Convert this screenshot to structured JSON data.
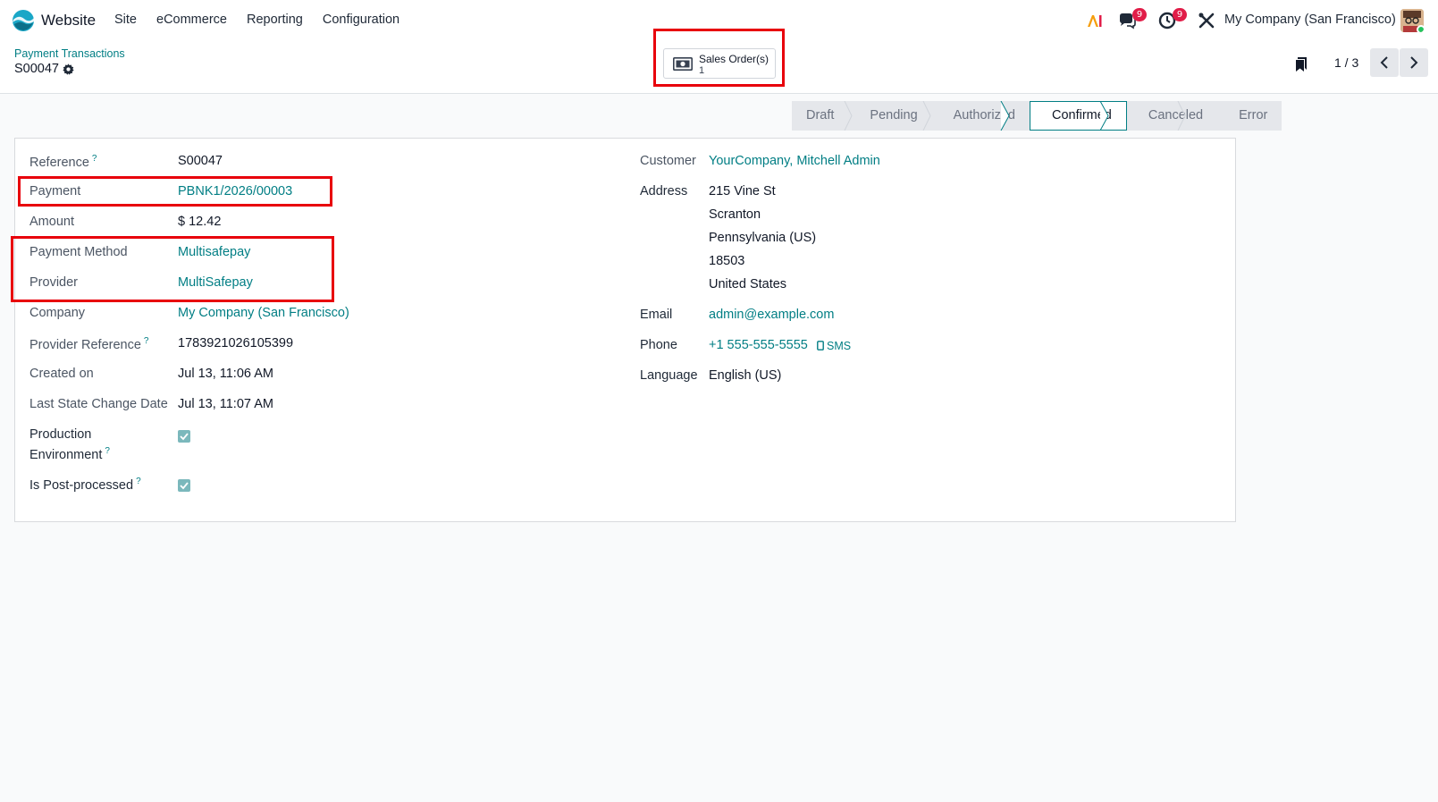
{
  "navbar": {
    "app_name": "Website",
    "menu": [
      "Site",
      "eCommerce",
      "Reporting",
      "Configuration"
    ],
    "messages_badge": "9",
    "activities_badge": "9",
    "company": "My Company (San Francisco)"
  },
  "control": {
    "breadcrumb": "Payment Transactions",
    "record": "S00047",
    "smart_button": {
      "label": "Sales Order(s)",
      "count": "1",
      "icon": "money-icon"
    },
    "pager": "1 / 3"
  },
  "statusbar": {
    "stages": [
      "Draft",
      "Pending",
      "Authorized",
      "Confirmed",
      "Canceled",
      "Error"
    ],
    "active": "Confirmed"
  },
  "left": {
    "reference": {
      "label": "Reference",
      "value": "S00047"
    },
    "payment": {
      "label": "Payment",
      "value": "PBNK1/2026/00003"
    },
    "amount": {
      "label": "Amount",
      "value": "$ 12.42"
    },
    "payment_method": {
      "label": "Payment Method",
      "value": "Multisafepay"
    },
    "provider": {
      "label": "Provider",
      "value": "MultiSafepay"
    },
    "company": {
      "label": "Company",
      "value": "My Company (San Francisco)"
    },
    "provider_reference": {
      "label": "Provider Reference",
      "value": "1783921026105399"
    },
    "created_on": {
      "label": "Created on",
      "value": "Jul 13, 11:06 AM"
    },
    "last_state_change": {
      "label": "Last State Change Date",
      "value": "Jul 13, 11:07 AM"
    },
    "production_env": {
      "label_1": "Production",
      "label_2": "Environment",
      "checked": true
    },
    "post_processed": {
      "label": "Is Post-processed",
      "checked": true
    }
  },
  "right": {
    "customer": {
      "label": "Customer",
      "value": "YourCompany, Mitchell Admin"
    },
    "address": {
      "label": "Address",
      "lines": [
        "215 Vine St",
        "Scranton",
        "Pennsylvania (US)",
        "18503",
        "United States"
      ]
    },
    "email": {
      "label": "Email",
      "value": "admin@example.com"
    },
    "phone": {
      "label": "Phone",
      "value": "+1 555-555-5555",
      "sms": "SMS"
    },
    "language": {
      "label": "Language",
      "value": "English (US)"
    }
  },
  "help_mark": "?",
  "colors": {
    "accent": "#017e84",
    "highlight": "#e8000b",
    "badge": "#e11d48"
  }
}
